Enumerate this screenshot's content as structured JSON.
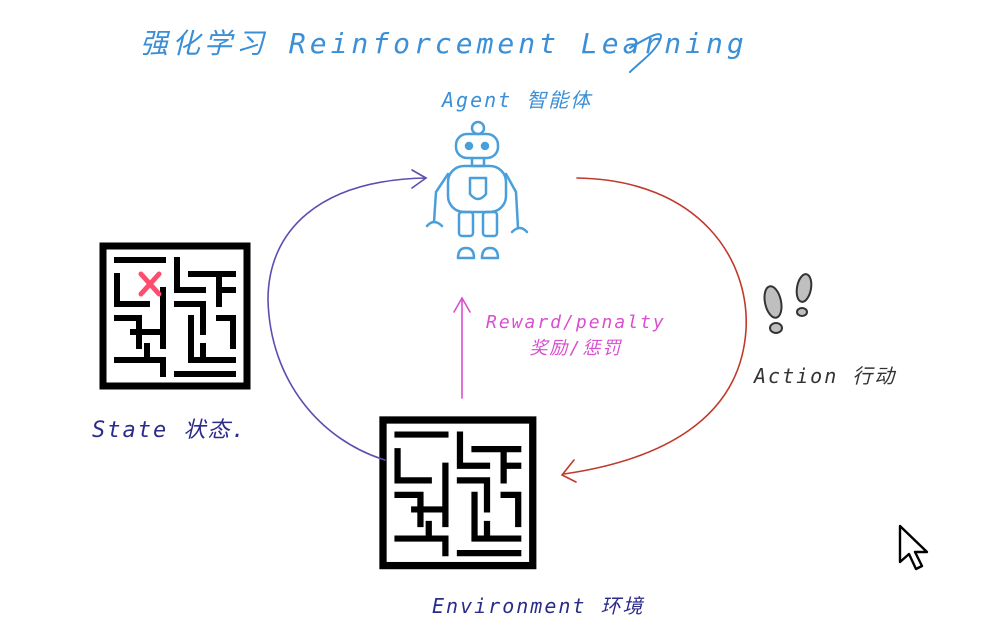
{
  "title": "强化学习 Reinforcement Learning",
  "agent": {
    "label": "Agent 智能体"
  },
  "state": {
    "label": "State 状态."
  },
  "reward": {
    "line1": "Reward/penalty",
    "line2": "奖励/惩罚"
  },
  "action": {
    "label": "Action 行动"
  },
  "environment": {
    "label": "Environment 环境"
  },
  "colors": {
    "title": "#3a8fd6",
    "agent_label": "#3a8fd6",
    "robot": "#4a9fdb",
    "state_label": "#2b2b8a",
    "environment_label": "#2b2b8a",
    "action_label": "#333333",
    "reward": "#d94fd1",
    "state_arrow": "#5a4fb0",
    "action_arrow": "#c0392b",
    "maze_marker": "#ff4d6d",
    "maze": "#000000"
  }
}
